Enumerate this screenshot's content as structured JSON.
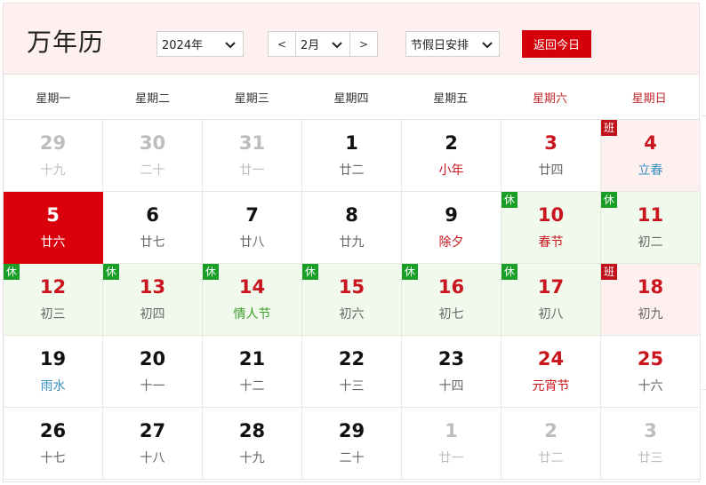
{
  "header": {
    "title": "万年历",
    "year_value": "2024年",
    "month_prev": "<",
    "month_value": "2月",
    "month_next": ">",
    "holiday_value": "节假日安排",
    "today_button": "返回今日"
  },
  "weekdays": [
    "星期一",
    "星期二",
    "星期三",
    "星期四",
    "星期五",
    "星期六",
    "星期日"
  ],
  "colors": {
    "accent": "#d6000b",
    "rest_bg": "#f0f9ec",
    "work_bg": "#fdf0ef",
    "rest_tag": "#1a9e25",
    "work_tag": "#c1121c"
  },
  "weeks": [
    [
      {
        "day": "29",
        "lunar": "十九",
        "other": true
      },
      {
        "day": "30",
        "lunar": "二十",
        "other": true
      },
      {
        "day": "31",
        "lunar": "廿一",
        "other": true
      },
      {
        "day": "1",
        "lunar": "廿二"
      },
      {
        "day": "2",
        "lunar": "小年",
        "lunar_color": "red"
      },
      {
        "day": "3",
        "lunar": "廿四",
        "day_color": "red"
      },
      {
        "day": "4",
        "lunar": "立春",
        "day_color": "red",
        "lunar_color": "blue",
        "status": "work",
        "tag": "班"
      }
    ],
    [
      {
        "day": "5",
        "lunar": "廿六",
        "today": true
      },
      {
        "day": "6",
        "lunar": "廿七"
      },
      {
        "day": "7",
        "lunar": "廿八"
      },
      {
        "day": "8",
        "lunar": "廿九"
      },
      {
        "day": "9",
        "lunar": "除夕",
        "lunar_color": "red"
      },
      {
        "day": "10",
        "lunar": "春节",
        "day_color": "red",
        "lunar_color": "red",
        "status": "rest",
        "tag": "休"
      },
      {
        "day": "11",
        "lunar": "初二",
        "day_color": "red",
        "status": "rest",
        "tag": "休"
      }
    ],
    [
      {
        "day": "12",
        "lunar": "初三",
        "day_color": "red",
        "status": "rest",
        "tag": "休"
      },
      {
        "day": "13",
        "lunar": "初四",
        "day_color": "red",
        "status": "rest",
        "tag": "休"
      },
      {
        "day": "14",
        "lunar": "情人节",
        "day_color": "red",
        "lunar_color": "green",
        "status": "rest",
        "tag": "休"
      },
      {
        "day": "15",
        "lunar": "初六",
        "day_color": "red",
        "status": "rest",
        "tag": "休"
      },
      {
        "day": "16",
        "lunar": "初七",
        "day_color": "red",
        "status": "rest",
        "tag": "休"
      },
      {
        "day": "17",
        "lunar": "初八",
        "day_color": "red",
        "status": "rest",
        "tag": "休"
      },
      {
        "day": "18",
        "lunar": "初九",
        "day_color": "red",
        "status": "work",
        "tag": "班"
      }
    ],
    [
      {
        "day": "19",
        "lunar": "雨水",
        "lunar_color": "blue"
      },
      {
        "day": "20",
        "lunar": "十一"
      },
      {
        "day": "21",
        "lunar": "十二"
      },
      {
        "day": "22",
        "lunar": "十三"
      },
      {
        "day": "23",
        "lunar": "十四"
      },
      {
        "day": "24",
        "lunar": "元宵节",
        "day_color": "red",
        "lunar_color": "red"
      },
      {
        "day": "25",
        "lunar": "十六",
        "day_color": "red"
      }
    ],
    [
      {
        "day": "26",
        "lunar": "十七"
      },
      {
        "day": "27",
        "lunar": "十八"
      },
      {
        "day": "28",
        "lunar": "十九"
      },
      {
        "day": "29",
        "lunar": "二十"
      },
      {
        "day": "1",
        "lunar": "廿一",
        "other": true
      },
      {
        "day": "2",
        "lunar": "廿二",
        "other": true
      },
      {
        "day": "3",
        "lunar": "廿三",
        "other": true
      }
    ]
  ]
}
